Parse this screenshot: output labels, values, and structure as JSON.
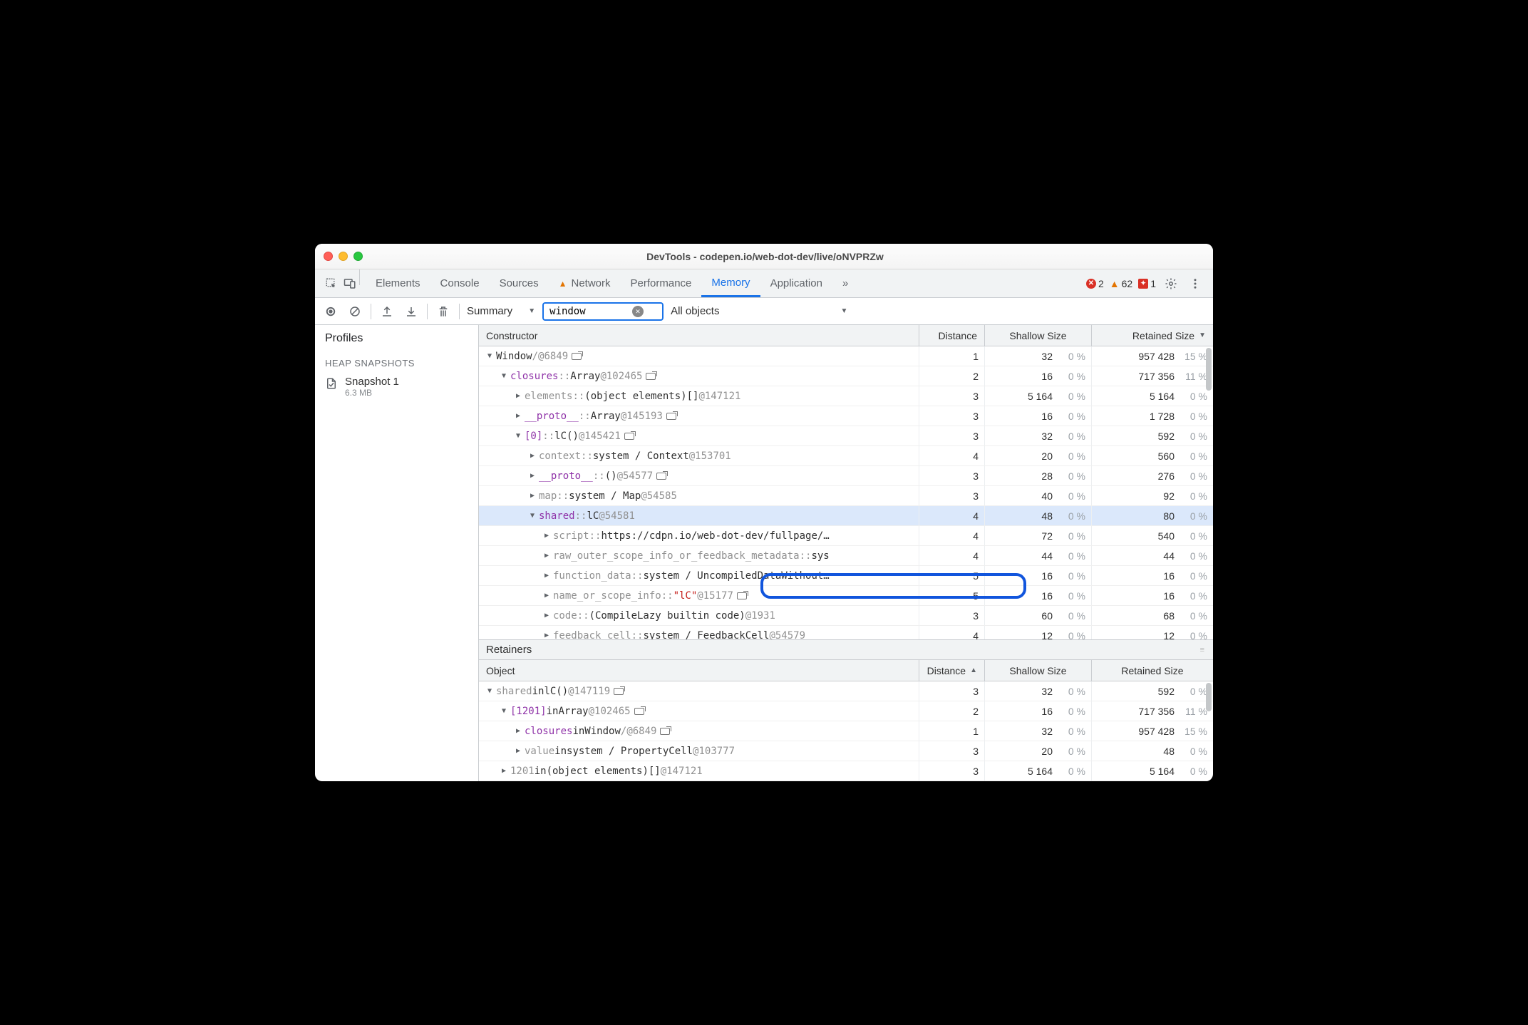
{
  "window": {
    "title": "DevTools - codepen.io/web-dot-dev/live/oNVPRZw"
  },
  "tabs": [
    "Elements",
    "Console",
    "Sources",
    "Network",
    "Performance",
    "Memory",
    "Application"
  ],
  "active_tab": "Memory",
  "warn_tab": "Network",
  "status": {
    "errors": 2,
    "warnings": 62,
    "issues": 1
  },
  "subtoolbar": {
    "view": "Summary",
    "filter": "window",
    "scope": "All objects"
  },
  "sidebar": {
    "title": "Profiles",
    "category": "HEAP SNAPSHOTS",
    "snapshot": {
      "name": "Snapshot 1",
      "size": "6.3 MB"
    }
  },
  "columns": {
    "c0": "Constructor",
    "c1": "Distance",
    "c2": "Shallow Size",
    "c3": "Retained Size"
  },
  "rows": [
    {
      "indent": 0,
      "exp": "open",
      "segs": [
        {
          "t": "Window"
        },
        {
          "t": " / ",
          "c": "dim"
        },
        {
          "t": "  @6849",
          "c": "objid"
        },
        {
          "link": true
        }
      ],
      "d": "1",
      "ss": "32",
      "ssp": "0 %",
      "rs": "957 428",
      "rsp": "15 %"
    },
    {
      "indent": 1,
      "exp": "open",
      "segs": [
        {
          "t": "closures",
          "c": "prop"
        },
        {
          "t": " :: ",
          "c": "sep"
        },
        {
          "t": "Array "
        },
        {
          "t": "@102465",
          "c": "objid"
        },
        {
          "link": true
        }
      ],
      "d": "2",
      "ss": "16",
      "ssp": "0 %",
      "rs": "717 356",
      "rsp": "11 %"
    },
    {
      "indent": 2,
      "exp": "closed",
      "segs": [
        {
          "t": "elements",
          "c": "dim"
        },
        {
          "t": " :: ",
          "c": "sep"
        },
        {
          "t": "(object elements)[] "
        },
        {
          "t": "@147121",
          "c": "objid"
        }
      ],
      "d": "3",
      "ss": "5 164",
      "ssp": "0 %",
      "rs": "5 164",
      "rsp": "0 %"
    },
    {
      "indent": 2,
      "exp": "closed",
      "segs": [
        {
          "t": "__proto__",
          "c": "prop"
        },
        {
          "t": " :: ",
          "c": "sep"
        },
        {
          "t": "Array "
        },
        {
          "t": "@145193",
          "c": "objid"
        },
        {
          "link": true
        }
      ],
      "d": "3",
      "ss": "16",
      "ssp": "0 %",
      "rs": "1 728",
      "rsp": "0 %"
    },
    {
      "indent": 2,
      "exp": "open",
      "segs": [
        {
          "t": "[0]",
          "c": "prop"
        },
        {
          "t": " :: ",
          "c": "sep"
        },
        {
          "t": "lC()",
          "c": ""
        },
        {
          "t": " @145421",
          "c": "objid"
        },
        {
          "link": true
        }
      ],
      "d": "3",
      "ss": "32",
      "ssp": "0 %",
      "rs": "592",
      "rsp": "0 %"
    },
    {
      "indent": 3,
      "exp": "closed",
      "segs": [
        {
          "t": "context",
          "c": "dim"
        },
        {
          "t": " :: ",
          "c": "sep"
        },
        {
          "t": "system / Context "
        },
        {
          "t": "@153701",
          "c": "objid"
        }
      ],
      "d": "4",
      "ss": "20",
      "ssp": "0 %",
      "rs": "560",
      "rsp": "0 %"
    },
    {
      "indent": 3,
      "exp": "closed",
      "segs": [
        {
          "t": "__proto__",
          "c": "prop"
        },
        {
          "t": " :: ",
          "c": "sep"
        },
        {
          "t": "() "
        },
        {
          "t": "@54577",
          "c": "objid"
        },
        {
          "link": true
        }
      ],
      "d": "3",
      "ss": "28",
      "ssp": "0 %",
      "rs": "276",
      "rsp": "0 %"
    },
    {
      "indent": 3,
      "exp": "closed",
      "segs": [
        {
          "t": "map",
          "c": "dim"
        },
        {
          "t": " :: ",
          "c": "sep"
        },
        {
          "t": "system / Map "
        },
        {
          "t": "@54585",
          "c": "objid"
        }
      ],
      "d": "3",
      "ss": "40",
      "ssp": "0 %",
      "rs": "92",
      "rsp": "0 %"
    },
    {
      "indent": 3,
      "exp": "open",
      "selected": true,
      "segs": [
        {
          "t": "shared",
          "c": "prop"
        },
        {
          "t": " :: ",
          "c": "sep"
        },
        {
          "t": "lC "
        },
        {
          "t": "@54581",
          "c": "objid"
        }
      ],
      "d": "4",
      "ss": "48",
      "ssp": "0 %",
      "rs": "80",
      "rsp": "0 %"
    },
    {
      "indent": 4,
      "exp": "closed",
      "segs": [
        {
          "t": "script",
          "c": "dim"
        },
        {
          "t": " :: ",
          "c": "sep"
        },
        {
          "t": "https://cdpn.io/web-dot-dev/fullpage/…"
        }
      ],
      "d": "4",
      "ss": "72",
      "ssp": "0 %",
      "rs": "540",
      "rsp": "0 %"
    },
    {
      "indent": 4,
      "exp": "closed",
      "segs": [
        {
          "t": "raw_outer_scope_info_or_feedback_metadata",
          "c": "dim"
        },
        {
          "t": " :: ",
          "c": "sep"
        },
        {
          "t": "sys"
        }
      ],
      "d": "4",
      "ss": "44",
      "ssp": "0 %",
      "rs": "44",
      "rsp": "0 %"
    },
    {
      "indent": 4,
      "exp": "closed",
      "segs": [
        {
          "t": "function_data",
          "c": "dim"
        },
        {
          "t": " :: ",
          "c": "sep"
        },
        {
          "t": "system / UncompiledDataWithout…"
        }
      ],
      "d": "5",
      "ss": "16",
      "ssp": "0 %",
      "rs": "16",
      "rsp": "0 %"
    },
    {
      "indent": 4,
      "exp": "closed",
      "outlined": true,
      "segs": [
        {
          "t": "name_or_scope_info",
          "c": "dim"
        },
        {
          "t": " :: ",
          "c": "sep"
        },
        {
          "t": "\"lC\"",
          "c": "strv"
        },
        {
          "t": " @15177",
          "c": "objid"
        },
        {
          "link": true
        }
      ],
      "d": "5",
      "ss": "16",
      "ssp": "0 %",
      "rs": "16",
      "rsp": "0 %"
    },
    {
      "indent": 4,
      "exp": "closed",
      "segs": [
        {
          "t": "code",
          "c": "dim"
        },
        {
          "t": " :: ",
          "c": "sep"
        },
        {
          "t": "(CompileLazy builtin code) "
        },
        {
          "t": "@1931",
          "c": "objid"
        }
      ],
      "d": "3",
      "ss": "60",
      "ssp": "0 %",
      "rs": "68",
      "rsp": "0 %"
    },
    {
      "indent": 4,
      "exp": "closed",
      "segs": [
        {
          "t": "feedback_cell",
          "c": "dim"
        },
        {
          "t": " :: ",
          "c": "sep"
        },
        {
          "t": "system / FeedbackCell "
        },
        {
          "t": "@54579",
          "c": "objid"
        }
      ],
      "d": "4",
      "ss": "12",
      "ssp": "0 %",
      "rs": "12",
      "rsp": "0 %"
    }
  ],
  "retainers": {
    "title": "Retainers",
    "columns": {
      "c0": "Object",
      "c1": "Distance",
      "c2": "Shallow Size",
      "c3": "Retained Size"
    },
    "rows": [
      {
        "indent": 0,
        "exp": "open",
        "segs": [
          {
            "t": "shared",
            "c": "dim"
          },
          {
            "t": " in "
          },
          {
            "t": "lC()",
            "c": ""
          },
          {
            "t": " @147119",
            "c": "objid"
          },
          {
            "link": true
          }
        ],
        "d": "3",
        "ss": "32",
        "ssp": "0 %",
        "rs": "592",
        "rsp": "0 %"
      },
      {
        "indent": 1,
        "exp": "open",
        "segs": [
          {
            "t": "[1201]",
            "c": "prop"
          },
          {
            "t": " in "
          },
          {
            "t": "Array "
          },
          {
            "t": "@102465",
            "c": "objid"
          },
          {
            "link": true
          }
        ],
        "d": "2",
        "ss": "16",
        "ssp": "0 %",
        "rs": "717 356",
        "rsp": "11 %"
      },
      {
        "indent": 2,
        "exp": "closed",
        "segs": [
          {
            "t": "closures",
            "c": "prop"
          },
          {
            "t": " in "
          },
          {
            "t": "Window"
          },
          {
            "t": " / ",
            "c": "dim"
          },
          {
            "t": "  @6849",
            "c": "objid"
          },
          {
            "link": true
          }
        ],
        "d": "1",
        "ss": "32",
        "ssp": "0 %",
        "rs": "957 428",
        "rsp": "15 %"
      },
      {
        "indent": 2,
        "exp": "closed",
        "segs": [
          {
            "t": "value",
            "c": "dim"
          },
          {
            "t": " in "
          },
          {
            "t": "system / PropertyCell "
          },
          {
            "t": "@103777",
            "c": "objid"
          }
        ],
        "d": "3",
        "ss": "20",
        "ssp": "0 %",
        "rs": "48",
        "rsp": "0 %"
      },
      {
        "indent": 1,
        "exp": "closed",
        "segs": [
          {
            "t": "1201",
            "c": "dim"
          },
          {
            "t": " in "
          },
          {
            "t": "(object elements)[] "
          },
          {
            "t": "@147121",
            "c": "objid"
          }
        ],
        "d": "3",
        "ss": "5 164",
        "ssp": "0 %",
        "rs": "5 164",
        "rsp": "0 %"
      }
    ]
  }
}
